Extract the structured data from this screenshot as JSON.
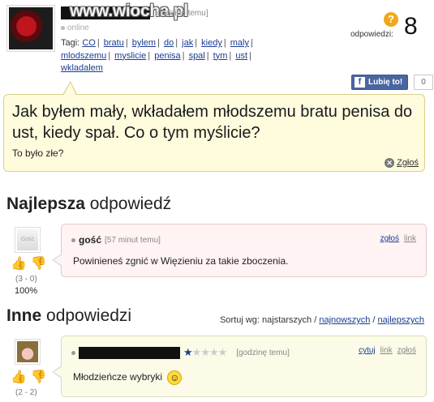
{
  "question": {
    "watermark": "www.wiocha.pl",
    "time": "[godzinę temu]",
    "status": "online",
    "tags_label": "Tagi:",
    "tags": [
      "CO",
      "bratu",
      "bylem",
      "do",
      "jak",
      "kiedy",
      "maly",
      "mlodszemu",
      "myslicie",
      "penisa",
      "spal",
      "tym",
      "ust",
      "wkladalem"
    ],
    "answers_label": "odpowiedzi:",
    "answers_count": "8",
    "answers_icon": "question-mark-icon",
    "like_label": "Lubię to!",
    "like_count": "0",
    "title": "Jak byłem mały, wkładałem młodszemu bratu penisa do ust, kiedy spał. Co o tym myślicie?",
    "description": "To było złe?",
    "report_label": "Zgłoś"
  },
  "best": {
    "heading_bold": "Najlepsza",
    "heading_rest": "odpowiedź",
    "avatar_label": "Gość",
    "author": "gość",
    "time": "[57 minut temu]",
    "link_report": "zgłoś",
    "link_link": "link",
    "text": "Powinieneś zgnić w Więzieniu za takie zboczenia.",
    "score": "(3 - 0)",
    "percent": "100%"
  },
  "others": {
    "heading_bold": "Inne",
    "heading_rest": "odpowiedzi",
    "sort_label": "Sortuj wg: najstarszych /",
    "sort_newest": "najnowszych",
    "sort_sep": "/",
    "sort_best": "najlepszych",
    "items": [
      {
        "time": "[godzinę temu]",
        "rating": 1,
        "link_quote": "cytuj",
        "link_link": "link",
        "link_report": "zgłoś",
        "text": "Młodzieńcze wybryki",
        "score": "(2 - 2)"
      }
    ]
  },
  "colors": {
    "link": "#1a3d8f",
    "question_bg": "#fffbdd",
    "best_bg": "#fff3f3",
    "other_bg": "#fbfbe8",
    "facebook": "#3b5998"
  }
}
